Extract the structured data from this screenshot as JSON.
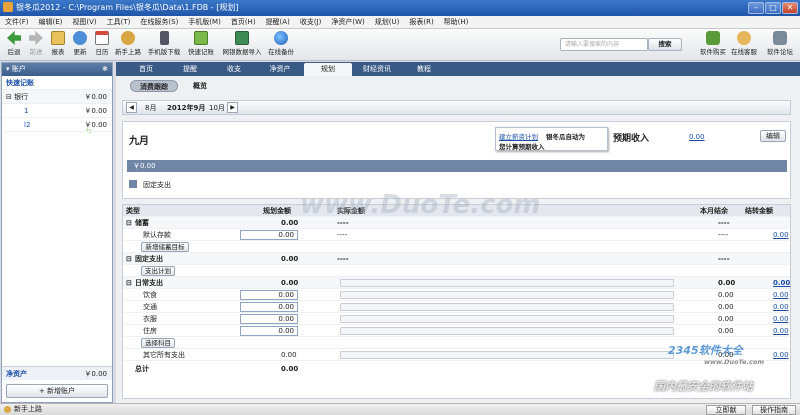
{
  "window": {
    "title": "银冬瓜2012 - C:\\Program Files\\银冬瓜\\Data\\1.FDB - [规划]"
  },
  "menu": [
    "文件(F)",
    "编辑(E)",
    "视图(V)",
    "工具(T)",
    "在线服务(S)",
    "手机版(M)",
    "首页(H)",
    "提醒(A)",
    "收支(J)",
    "净资产(W)",
    "规划(U)",
    "报表(R)",
    "帮助(H)"
  ],
  "toolbar": {
    "buttons": [
      "后退",
      "前进",
      "报表",
      "更新",
      "日历",
      "新手上路",
      "手机版下载",
      "快速记账",
      "网银数据导入",
      "在线备份"
    ],
    "search_placeholder": "请输入要搜索的内容",
    "search_button": "搜索",
    "right_buttons": [
      "软件购买",
      "在线客服",
      "软件论坛"
    ]
  },
  "sidebar": {
    "header": "账户",
    "quick": "快速记账",
    "group": {
      "label": "银行",
      "value": "￥0.00"
    },
    "items": [
      {
        "label": "1",
        "value": "￥0.00"
      },
      {
        "label": "l2",
        "value": "￥0.00"
      }
    ],
    "net_asset_label": "净资产",
    "net_asset_value": "￥0.00",
    "add_account": "新增账户"
  },
  "tabs": [
    "首页",
    "提醒",
    "收支",
    "净资产",
    "规划",
    "财经资讯",
    "教程"
  ],
  "active_tab": "规划",
  "subtabs": [
    "消费跟踪",
    "概览"
  ],
  "month_nav": {
    "prev": "8月",
    "current": "2012年9月",
    "next": "10月"
  },
  "card": {
    "month": "九月",
    "callout_link": "建立薪资计划",
    "callout_text1": "银冬瓜自动为",
    "callout_text2": "您计算预期收入",
    "expected_income_label": "预期收入",
    "expected_income_value": "0.00",
    "edit_button": "编辑",
    "bar_value": "￥0.00",
    "legend_label": "固定支出"
  },
  "table": {
    "headers": [
      "类型",
      "规划金额",
      "实际金额",
      "本月结余",
      "结转金额"
    ],
    "savings": {
      "label": "储蓄",
      "planned": "0.00",
      "actual": "----",
      "balance": "----",
      "rows": [
        {
          "label": "默认存款",
          "planned": "0.00",
          "actual": "----",
          "balance": "----",
          "carry": "0.00"
        }
      ],
      "add_button": "新增储蓄目标"
    },
    "fixed": {
      "label": "固定支出",
      "planned": "0.00",
      "actual": "----",
      "balance": "----",
      "button": "支出计划"
    },
    "daily": {
      "label": "日常支出",
      "planned": "0.00",
      "balance": "0.00",
      "carry": "0.00",
      "rows": [
        {
          "label": "饮食",
          "planned": "0.00",
          "balance": "0.00",
          "carry": "0.00"
        },
        {
          "label": "交通",
          "planned": "0.00",
          "balance": "0.00",
          "carry": "0.00"
        },
        {
          "label": "衣服",
          "planned": "0.00",
          "balance": "0.00",
          "carry": "0.00"
        },
        {
          "label": "住房",
          "planned": "0.00",
          "balance": "0.00",
          "carry": "0.00"
        }
      ],
      "select_button": "选择科目",
      "other": {
        "label": "其它所有支出",
        "planned": "0.00",
        "balance": "0.00",
        "carry": "0.00"
      }
    },
    "total": {
      "label": "总计",
      "value": "0.00"
    }
  },
  "statusbar": {
    "left": "新手上路",
    "btn1": "立即献",
    "btn2": "操作指南"
  },
  "watermarks": {
    "main": "www.DuoTe.com",
    "logo": "2345软件大全",
    "logo_url": "www.DuoTe.com",
    "slogan": "国内最安全的软件站"
  }
}
